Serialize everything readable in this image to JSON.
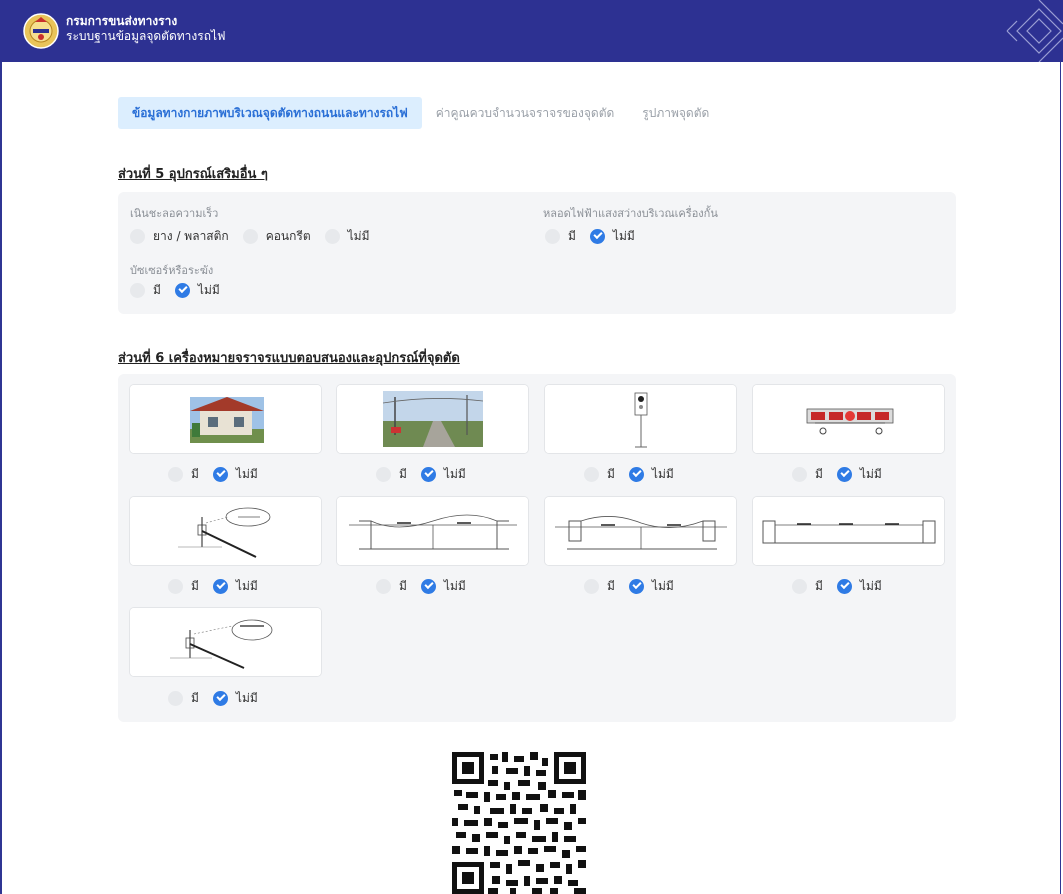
{
  "header": {
    "org": "กรมการขนส่งทางราง",
    "system": "ระบบฐานข้อมูลจุดตัดทางรถไฟ",
    "logo_icon": "emblem-seal-icon",
    "bg_color": "#2d3192"
  },
  "tabs": [
    {
      "label": "ข้อมูลทางกายภาพบริเวณจุดตัดทางถนนและทางรถไฟ",
      "active": true
    },
    {
      "label": "ค่าคูณควบจำนวนจราจรของจุดตัด",
      "active": false
    },
    {
      "label": "รูปภาพจุดตัด",
      "active": false
    }
  ],
  "section5": {
    "title": "ส่วนที่ 5 อุปกรณ์เสริมอื่น ๆ",
    "speed_bump": {
      "label": "เนินชะลอความเร็ว",
      "options": [
        {
          "label": "ยาง / พลาสติก",
          "checked": false
        },
        {
          "label": "คอนกรีต",
          "checked": false
        },
        {
          "label": "ไม่มี",
          "checked": false
        }
      ]
    },
    "lighting": {
      "label": "หลอดไฟฟ้าแสงสว่างบริเวณเครื่องกั้น",
      "options": [
        {
          "label": "มี",
          "checked": false
        },
        {
          "label": "ไม่มี",
          "checked": true
        }
      ]
    },
    "buzzer": {
      "label": "บัซเซอร์หรือระฆัง",
      "options": [
        {
          "label": "มี",
          "checked": false
        },
        {
          "label": "ไม่มี",
          "checked": true
        }
      ]
    }
  },
  "section6": {
    "title": "ส่วนที่ 6 เครื่องหมายจราจรแบบตอบสนองและอุปกรณ์ที่จุดตัด",
    "yes_label": "มี",
    "no_label": "ไม่มี",
    "items": [
      {
        "icon": "guard-house-photo",
        "checked_no": true
      },
      {
        "icon": "crossing-road-photo",
        "checked_no": true
      },
      {
        "icon": "signal-post-icon",
        "checked_no": true
      },
      {
        "icon": "warning-barrier-icon",
        "checked_no": true
      },
      {
        "icon": "barrier-arm-diagram-icon",
        "checked_no": true
      },
      {
        "icon": "double-gate-diagram-icon",
        "checked_no": true
      },
      {
        "icon": "double-gate-diagram-2-icon",
        "checked_no": true
      },
      {
        "icon": "single-gate-diagram-icon",
        "checked_no": true
      },
      {
        "icon": "barrier-detail-diagram-icon",
        "checked_no": true
      }
    ]
  },
  "qr": {
    "icon": "qr-code-icon"
  },
  "colors": {
    "accent": "#2f7be5",
    "tab_bg": "#dceefe",
    "panel_bg": "#f4f5f7"
  }
}
